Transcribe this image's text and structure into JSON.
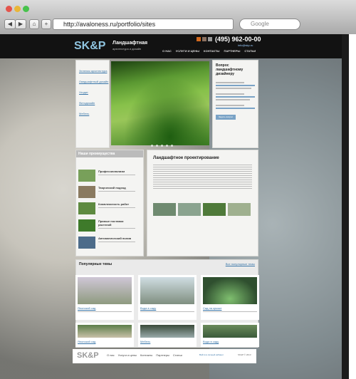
{
  "browser": {
    "url": "http://avaloness.ru/portfolio/sites",
    "search_placeholder": "Google",
    "back": "◀",
    "forward": "▶",
    "home": "⌂",
    "add": "+"
  },
  "site": {
    "logo": "SK&P",
    "logo_title": "Ландшафтная",
    "logo_sub": "архитектура и дизайн",
    "phone": "(495) 962-00-00",
    "email": "info@skp.ru",
    "menu": [
      "О НАС",
      "УСЛУГИ И ЦЕНЫ",
      "КОНТАКТЫ",
      "ПАРТНЕРЫ",
      "СТАТЬИ"
    ],
    "left_nav": [
      "Зеленая архитектура",
      "Ландшафтный дизайн",
      "Уходит",
      "Фитодизайн",
      "Мебель"
    ],
    "question_title": "Вопрос ландшафтному дизайнеру",
    "question_button": "Задать вопрос",
    "advantages_title": "Наши преимущества",
    "advantages": [
      "Профессионализм",
      "Творческий подход",
      "Комплексность работ",
      "Прямые поставки растений",
      "Автоматический полив"
    ],
    "article_title": "Ландшафтное проектирование",
    "popular_title": "Популярные темы",
    "all_link": "Все популярные темы",
    "cards": [
      "Японский сад",
      "Вода в саду",
      "Сад на крыше",
      "Японский сад",
      "Мебель",
      "Вода в саду"
    ],
    "footer_logo": "SK&P",
    "footer_nav": [
      "О нас",
      "Услуги и цены",
      "Контакты",
      "Партнеры",
      "Статьи"
    ],
    "footer_note": "Войти в личный кабинет",
    "copyright": "SK&P © 2013"
  },
  "colors": {
    "accent": "#8fc4e0",
    "link": "#3875a8"
  }
}
